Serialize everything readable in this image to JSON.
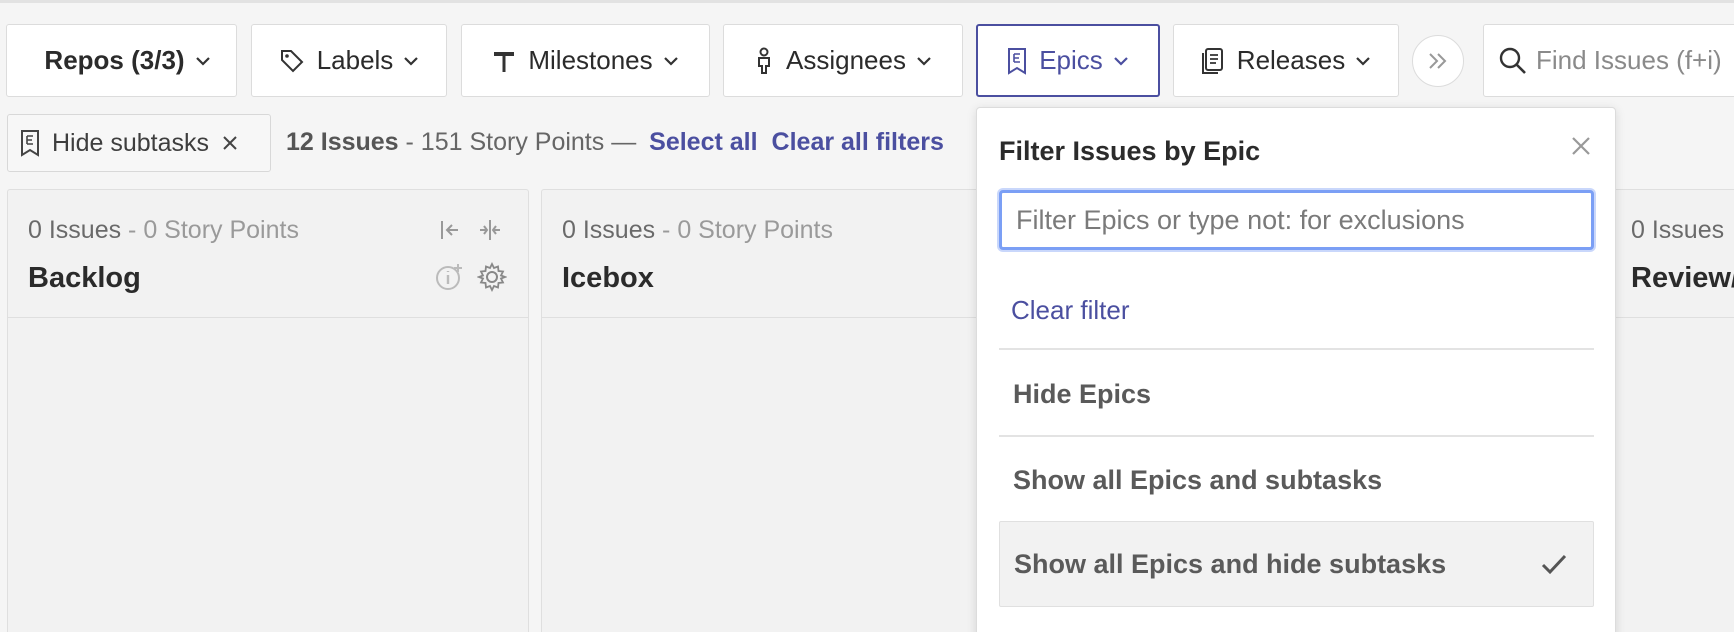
{
  "toolbar": {
    "repos": "Repos (3/3)",
    "labels": "Labels",
    "milestones": "Milestones",
    "assignees": "Assignees",
    "epics": "Epics",
    "releases": "Releases",
    "search_placeholder": "Find Issues (f+i)"
  },
  "filter_chip": {
    "label": "Hide subtasks"
  },
  "summary": {
    "issues": "12 Issues",
    "points": " - 151 Story Points — ",
    "select_all": "Select all",
    "clear_filters": "Clear all filters"
  },
  "columns": [
    {
      "count": "0 Issues",
      "points": " - 0 Story Points",
      "title": "Backlog"
    },
    {
      "count": "0 Issues",
      "points": " - 0 Story Points",
      "title": "Icebox"
    },
    {
      "count": "0 Issues",
      "points": "",
      "title": "Review/"
    }
  ],
  "epic_dropdown": {
    "title": "Filter Issues by Epic",
    "input_placeholder": "Filter Epics or type not: for exclusions",
    "clear_filter": "Clear filter",
    "options": [
      {
        "label": "Hide Epics",
        "selected": false
      },
      {
        "label": "Show all Epics and subtasks",
        "selected": false
      },
      {
        "label": "Show all Epics and hide subtasks",
        "selected": true
      }
    ]
  },
  "colors": {
    "accent": "#4b4fa0",
    "focus_ring": "#7b9ff5",
    "background": "#f5f5f5"
  },
  "icons": [
    "chevron-down-icon",
    "tag-icon",
    "milestone-icon",
    "assignee-icon",
    "epic-icon",
    "releases-icon",
    "double-chevron-right-icon",
    "search-icon",
    "close-icon",
    "collapse-left-icon",
    "collapse-column-icon",
    "info-add-icon",
    "gear-icon",
    "checkmark-icon"
  ]
}
